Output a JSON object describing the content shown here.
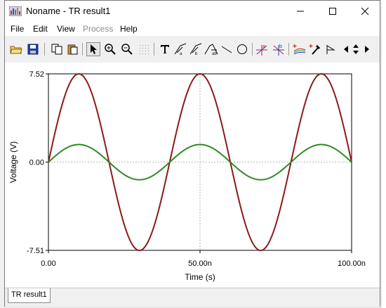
{
  "window": {
    "title": "Noname - TR result1"
  },
  "menu": {
    "file": "File",
    "edit": "Edit",
    "view": "View",
    "process": "Process",
    "help": "Help"
  },
  "toolbar": {
    "icons": [
      "open-folder-icon",
      "save-icon",
      "copy-icon",
      "paste-icon",
      "pointer-icon",
      "zoom-in-icon",
      "zoom-out-icon",
      "grid-icon",
      "text-icon",
      "cursor-a-icon",
      "cursor-b-icon",
      "cursor-ab-icon",
      "line-icon",
      "ellipse-icon",
      "marker-a-icon",
      "marker-b-icon",
      "add-curve-icon",
      "pick-color-icon",
      "flag-icon",
      "scroll-arrows-icon"
    ]
  },
  "chart_data": {
    "type": "line",
    "xlabel": "Time (s)",
    "ylabel": "Voltage (V)",
    "xlim": [
      0,
      100
    ],
    "ylim": [
      -7.51,
      7.52
    ],
    "x_unit": "ns",
    "x_ticks": [
      "0.00",
      "50.00n",
      "100.00n"
    ],
    "x_tick_values": [
      0,
      50,
      100
    ],
    "y_ticks": [
      "7.52",
      "0.00",
      "-7.51"
    ],
    "y_tick_values": [
      7.52,
      0,
      -7.51
    ],
    "grid": true,
    "series": [
      {
        "color": "#8b1a1a",
        "amplitude": 7.52,
        "period": 40,
        "x": [
          0,
          2.5,
          5,
          7.5,
          10,
          12.5,
          15,
          17.5,
          20,
          22.5,
          25,
          27.5,
          30,
          32.5,
          35,
          37.5,
          40,
          42.5,
          45,
          47.5,
          50,
          52.5,
          55,
          57.5,
          60,
          62.5,
          65,
          67.5,
          70,
          72.5,
          75,
          77.5,
          80,
          82.5,
          85,
          87.5,
          90,
          92.5,
          95,
          97.5,
          100
        ],
        "values": [
          0,
          2.88,
          5.32,
          6.95,
          7.52,
          6.95,
          5.32,
          2.88,
          0,
          -2.87,
          -5.31,
          -6.94,
          -7.51,
          -6.94,
          -5.31,
          -2.87,
          0,
          2.88,
          5.32,
          6.95,
          7.52,
          6.95,
          5.32,
          2.88,
          0,
          -2.87,
          -5.31,
          -6.94,
          -7.51,
          -6.94,
          -5.31,
          -2.87,
          0,
          2.88,
          5.32,
          6.95,
          7.52,
          6.95,
          5.32,
          2.88,
          0
        ]
      },
      {
        "color": "#2e8b22",
        "amplitude": 1.5,
        "period": 40,
        "x": [
          0,
          2.5,
          5,
          7.5,
          10,
          12.5,
          15,
          17.5,
          20,
          22.5,
          25,
          27.5,
          30,
          32.5,
          35,
          37.5,
          40,
          42.5,
          45,
          47.5,
          50,
          52.5,
          55,
          57.5,
          60,
          62.5,
          65,
          67.5,
          70,
          72.5,
          75,
          77.5,
          80,
          82.5,
          85,
          87.5,
          90,
          92.5,
          95,
          97.5,
          100
        ],
        "values": [
          0,
          0.57,
          1.06,
          1.39,
          1.5,
          1.39,
          1.06,
          0.57,
          0,
          -0.57,
          -1.06,
          -1.39,
          -1.5,
          -1.39,
          -1.06,
          -0.57,
          0,
          0.57,
          1.06,
          1.39,
          1.5,
          1.39,
          1.06,
          0.57,
          0,
          -0.57,
          -1.06,
          -1.39,
          -1.5,
          -1.39,
          -1.06,
          -0.57,
          0,
          0.57,
          1.06,
          1.39,
          1.5,
          1.39,
          1.06,
          0.57,
          0
        ]
      }
    ]
  },
  "tabs": {
    "active": "TR result1"
  },
  "colors": {
    "red_curve": "#8b1a1a",
    "green_curve": "#2e8b22",
    "grid": "#b4b4b4"
  }
}
